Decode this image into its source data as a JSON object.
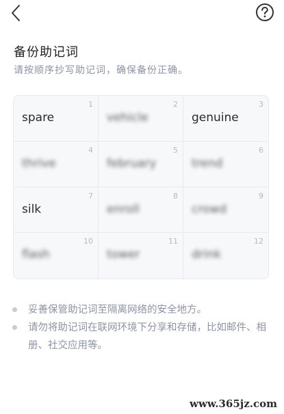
{
  "header": {
    "back_icon": "chevron-left-icon",
    "help_icon": "question-circle-icon"
  },
  "page": {
    "title": "备份助记词",
    "subtitle": "请按顺序抄写助记词，确保备份正确。"
  },
  "words": [
    {
      "index": "1",
      "text": "spare",
      "obscured": false
    },
    {
      "index": "2",
      "text": "vehicle",
      "obscured": true
    },
    {
      "index": "3",
      "text": "genuine",
      "obscured": false
    },
    {
      "index": "4",
      "text": "thrive",
      "obscured": true
    },
    {
      "index": "5",
      "text": "february",
      "obscured": true
    },
    {
      "index": "6",
      "text": "trend",
      "obscured": true
    },
    {
      "index": "7",
      "text": "silk",
      "obscured": false
    },
    {
      "index": "8",
      "text": "enroll",
      "obscured": true
    },
    {
      "index": "9",
      "text": "crowd",
      "obscured": true
    },
    {
      "index": "10",
      "text": "flash",
      "obscured": true
    },
    {
      "index": "11",
      "text": "tower",
      "obscured": true
    },
    {
      "index": "12",
      "text": "drink",
      "obscured": true
    }
  ],
  "tips": [
    "妥善保管助记词至隔离网络的安全地方。",
    "请勿将助记词在联网环境下分享和存储，比如邮件、相册、社交应用等。"
  ],
  "watermark": "www.365jz.com",
  "colors": {
    "text_primary": "#222222",
    "text_secondary": "#8c93a3",
    "grid_bg": "#f7f8fa",
    "grid_border": "#e6e9ef"
  }
}
